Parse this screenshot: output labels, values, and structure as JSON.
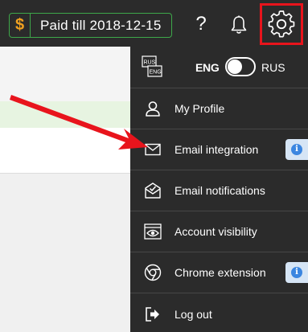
{
  "topbar": {
    "paid_symbol": "$",
    "paid_label": "Paid till 2018-12-15",
    "help_label": "?"
  },
  "language": {
    "icon_top": "RUS",
    "icon_bottom": "ENG",
    "left_label": "ENG",
    "right_label": "RUS",
    "selected": "ENG"
  },
  "menu": {
    "items": [
      {
        "label": "My Profile",
        "icon": "user-icon"
      },
      {
        "label": "Email integration",
        "icon": "envelope-icon",
        "info": true
      },
      {
        "label": "Email notifications",
        "icon": "envelope-check-icon"
      },
      {
        "label": "Account visibility",
        "icon": "eye-icon"
      },
      {
        "label": "Chrome extension",
        "icon": "chrome-icon",
        "info": true
      },
      {
        "label": "Log out",
        "icon": "logout-icon"
      }
    ]
  },
  "info_glyph": "i",
  "colors": {
    "topbar_bg": "#2b2b2b",
    "badge_border": "#3ea84a",
    "dollar": "#f0a020",
    "highlight": "#e8141c",
    "arrow": "#e8141c",
    "info_badge_bg": "#d6e5f5",
    "info_dot": "#3b86e0"
  }
}
